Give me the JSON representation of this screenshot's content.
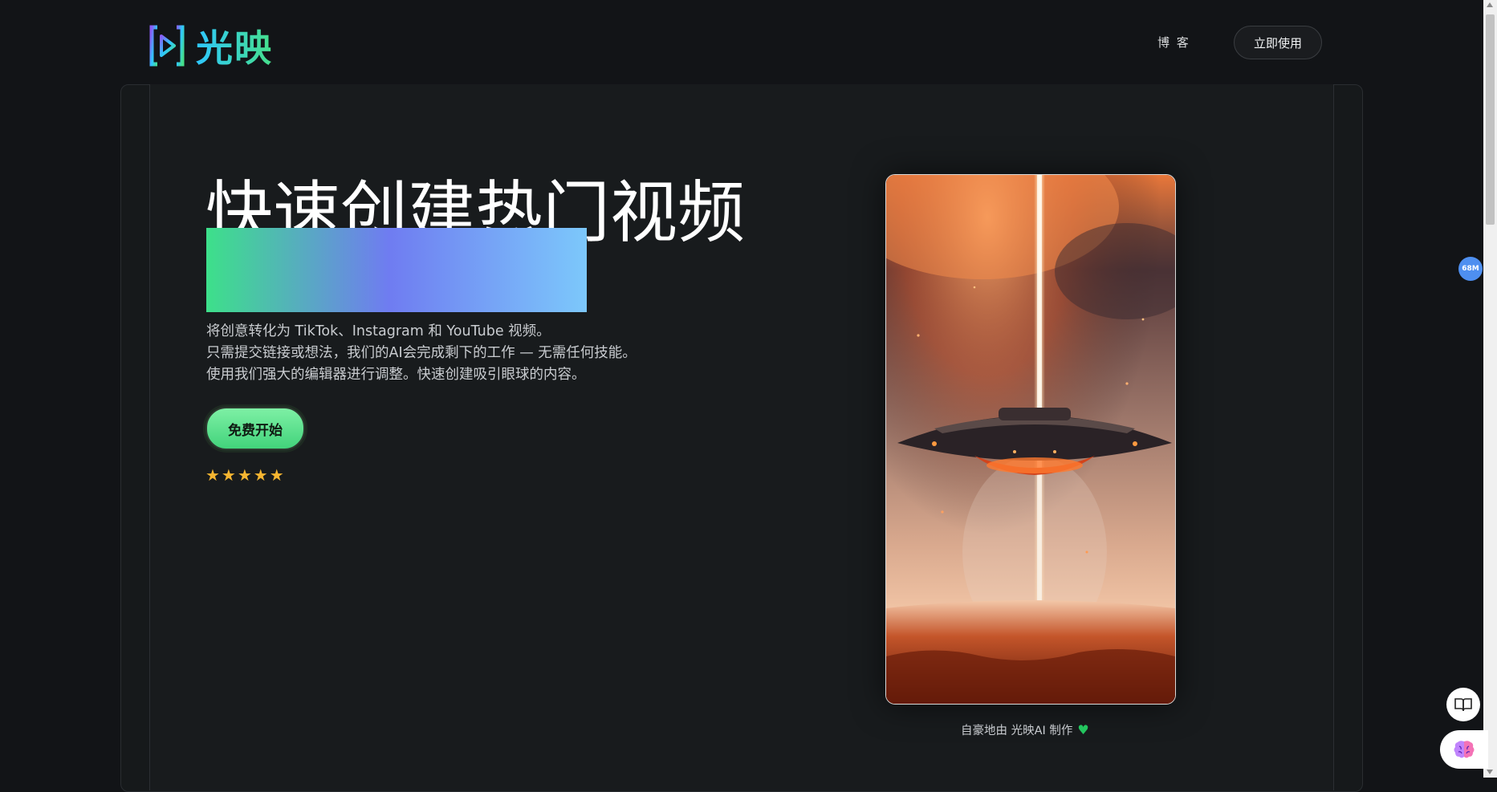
{
  "header": {
    "brand": "光映",
    "nav_blog": "博 客",
    "cta": "立即使用"
  },
  "hero": {
    "title": "快速创建热门视频",
    "desc_lines": [
      "将创意转化为 TikTok、Instagram 和 YouTube 视频。",
      "只需提交链接或想法，我们的AI会完成剩下的工作 — 无需任何技能。",
      "使用我们强大的编辑器进行调整。快速创建吸引眼球的内容。"
    ],
    "start_button": "免费开始",
    "stars": "★★★★★",
    "rating": 5
  },
  "showcase": {
    "caption": "自豪地由 光映AI 制作"
  },
  "widgets": {
    "memory_badge": "68M"
  },
  "icons": {
    "logo": "play-bracket-logo-icon",
    "heart": "heart-icon",
    "book": "book-open-icon",
    "brain": "brain-icon"
  },
  "colors": {
    "accent_green": "#42d37b",
    "gradient": [
      "#3de08a",
      "#6f7cf1",
      "#7cc8fb"
    ],
    "stars": "#f5b531",
    "background": "#121417"
  }
}
